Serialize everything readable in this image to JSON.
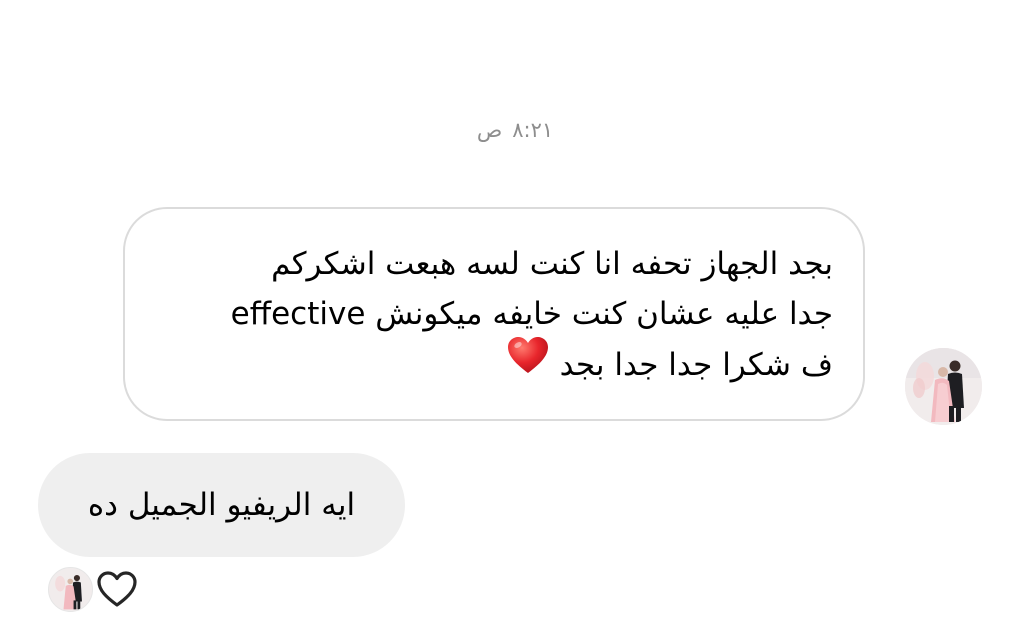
{
  "conversation": {
    "timestamp": {
      "time": "٨:٢١",
      "period": "ص"
    },
    "incoming_message": {
      "lines": [
        "بجد الجهاز تحفه انا كنت لسه هبعت اشكركم",
        "جدا عليه عشان كنت خايفه ميكونش effective",
        "ف شكرا جدا جدا بجد"
      ],
      "emoji": "red-heart"
    },
    "outgoing_message": {
      "text": "ايه الريفيو الجميل ده"
    },
    "reaction": {
      "icon": "heart-outline-icon"
    }
  },
  "colors": {
    "background": "#ffffff",
    "incoming_border": "#dbdbdb",
    "outgoing_bg": "#efefef",
    "timestamp": "#8e8e8e",
    "heart": "#e0262d"
  }
}
